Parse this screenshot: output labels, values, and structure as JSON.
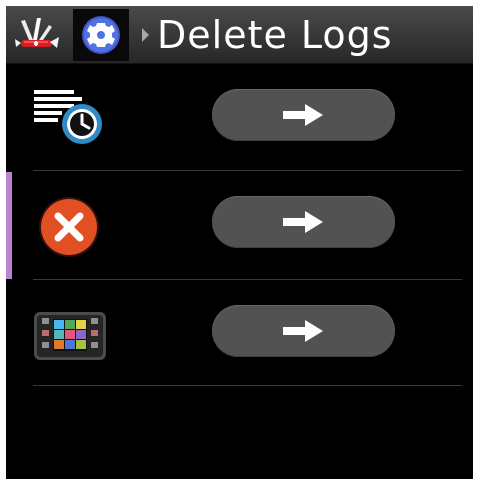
{
  "header": {
    "title": "Delete Logs",
    "app_icon": "swiss-army-knife-icon",
    "settings_icon": "gear-icon",
    "breadcrumb_icon": "chevron-right-icon"
  },
  "rows": [
    {
      "icon": "recent-logs-icon",
      "action_icon": "arrow-right-icon"
    },
    {
      "icon": "close-icon",
      "action_icon": "arrow-right-icon"
    },
    {
      "icon": "device-grid-icon",
      "action_icon": "arrow-right-icon"
    }
  ],
  "colors": {
    "background": "#000000",
    "header": "#303030",
    "selected_marker": "#b784d2",
    "delete_orange": "#e24f22",
    "button": "#525252",
    "accent_blue": "#4a68d8"
  }
}
